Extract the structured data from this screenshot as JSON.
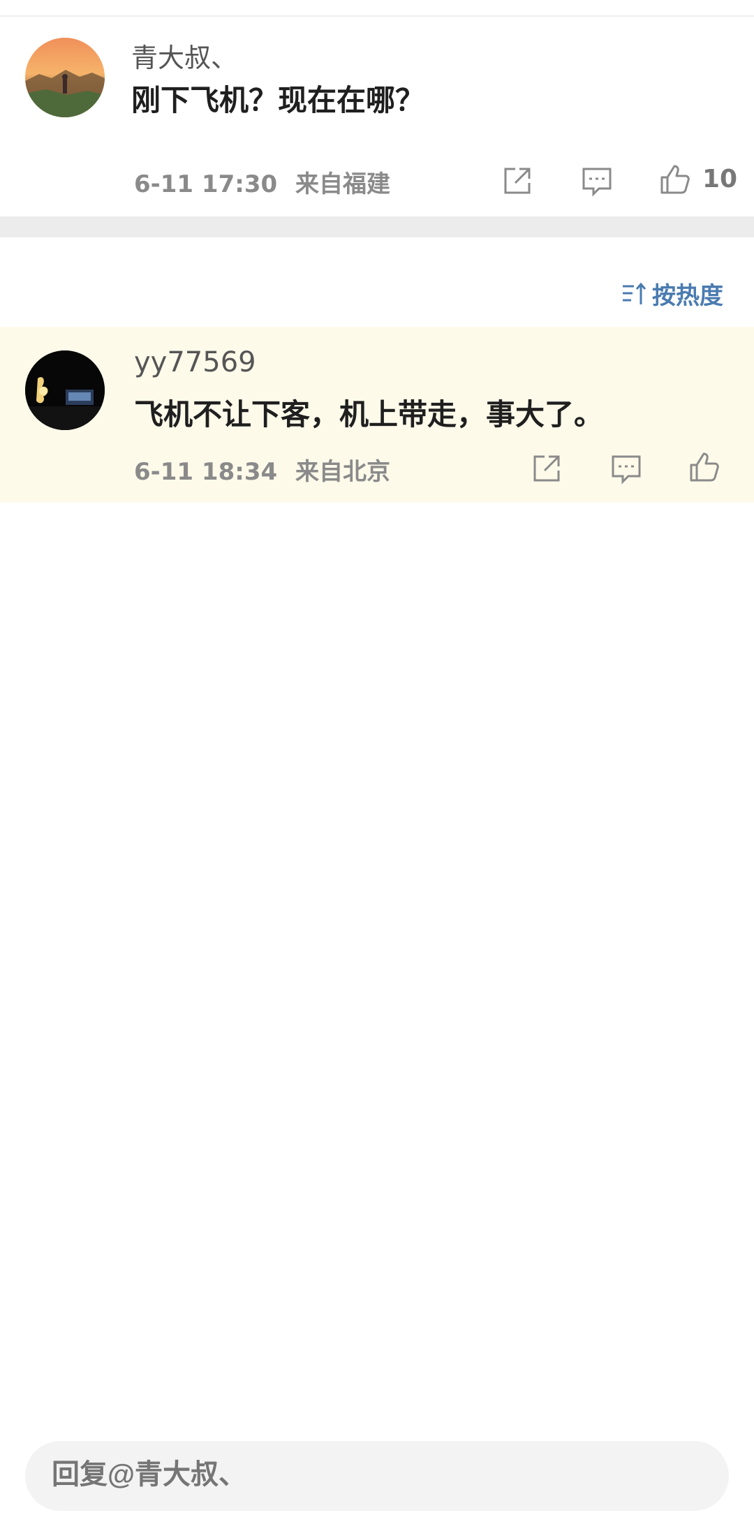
{
  "root_comment": {
    "username": "青大叔、",
    "content": "刚下飞机？现在在哪？",
    "date": "6-11 17:30",
    "location": "来自福建",
    "like_count": "10",
    "icons": [
      "share-icon",
      "comment-icon",
      "like-icon"
    ]
  },
  "sort": {
    "label": "按热度",
    "icon": "sort-icon"
  },
  "replies": [
    {
      "username": "yy77569",
      "content": "飞机不让下客，机上带走，事大了。",
      "date": "6-11 18:34",
      "location": "来自北京",
      "icons": [
        "share-icon",
        "comment-icon",
        "like-icon"
      ]
    }
  ],
  "reply_bar": {
    "placeholder": "回复@青大叔、"
  },
  "colors": {
    "highlight_bg": "#fdfaea",
    "divider": "#ececec",
    "link_blue": "#4a7bb0",
    "meta_gray": "#8a8a8a"
  }
}
